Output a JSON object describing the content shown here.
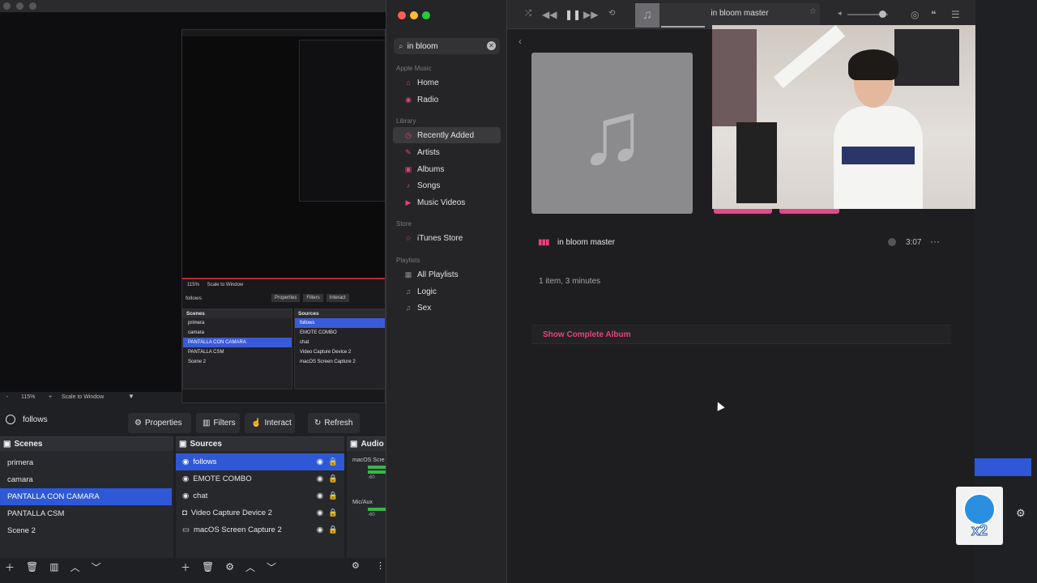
{
  "obs": {
    "nested": {
      "toolbar_zoom": "115%",
      "toolbar_scale": "Scale to Window",
      "source_name": "follows",
      "buttons": [
        "Properties",
        "Filters",
        "Interact"
      ],
      "scenes_title": "Scenes",
      "sources_title": "Sources",
      "scenes": [
        "primera",
        "camara",
        "PANTALLA CON CAMARA",
        "PANTALLA CSM",
        "Scene 2"
      ],
      "sources": [
        "follows",
        "EMOTE COMBO",
        "chat",
        "Video Capture Device 2",
        "macOS Screen Capture 2"
      ]
    },
    "toolbar": {
      "minus": "-",
      "zoom": "115%",
      "plus": "+",
      "scale": "Scale to Window"
    },
    "source_name": "follows",
    "buttons": {
      "properties": "Properties",
      "filters": "Filters",
      "interact": "Interact",
      "refresh": "Refresh"
    },
    "scenes": {
      "title": "Scenes",
      "items": [
        "primera",
        "camara",
        "PANTALLA CON CAMARA",
        "PANTALLA CSM",
        "Scene 2"
      ],
      "selected_index": 2
    },
    "sources": {
      "title": "Sources",
      "items": [
        "follows",
        "EMOTE COMBO",
        "chat",
        "Video Capture Device 2",
        "macOS Screen Capture 2"
      ],
      "selected_index": 0
    },
    "audio": {
      "title": "Audio M",
      "ch1": "macOS Scre",
      "ch2": "Mic/Aux",
      "db": "-60"
    }
  },
  "music": {
    "search": {
      "value": "in bloom"
    },
    "sections": {
      "apple_music": "Apple Music",
      "library": "Library",
      "store": "Store",
      "playlists": "Playlists"
    },
    "nav": {
      "home": "Home",
      "radio": "Radio",
      "recently_added": "Recently Added",
      "artists": "Artists",
      "albums": "Albums",
      "songs": "Songs",
      "music_videos": "Music Videos",
      "itunes_store": "iTunes Store",
      "all_playlists": "All Playlists",
      "logic": "Logic",
      "sex": "Sex"
    },
    "now_playing": {
      "title": "in bloom master"
    },
    "track": {
      "title": "in bloom master",
      "duration": "3:07"
    },
    "summary": "1 item, 3 minutes",
    "show_album": "Show Complete Album",
    "accent": "#e6447a"
  },
  "overlay": {
    "badge": "x2"
  }
}
